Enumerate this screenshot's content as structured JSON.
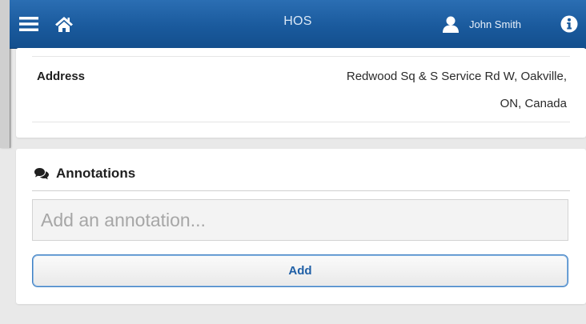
{
  "header": {
    "title": "HOS",
    "user_name": "John Smith",
    "menu_icon": "hamburger-menu-icon",
    "home_icon": "home-icon",
    "user_icon": "user-icon",
    "info_icon": "info-icon",
    "bar_color": "#1a5a9d"
  },
  "address": {
    "label": "Address",
    "value_line1": "Redwood Sq & S Service Rd W, Oakville,",
    "value_line2": "ON, Canada"
  },
  "annotations": {
    "icon": "comments-icon",
    "title": "Annotations",
    "input_placeholder": "Add an annotation...",
    "input_value": "",
    "add_label": "Add",
    "accent_color": "#1f5fa6"
  }
}
